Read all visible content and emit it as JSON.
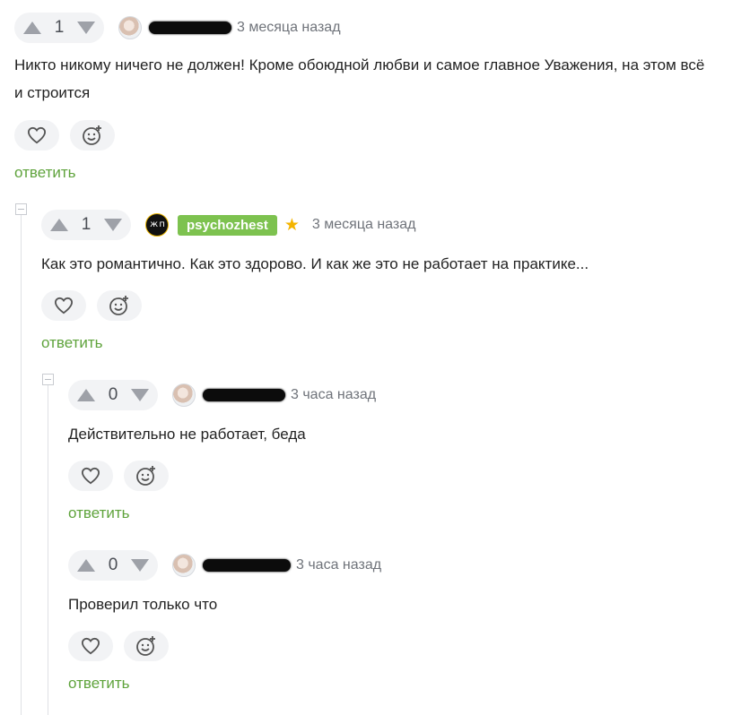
{
  "comments": [
    {
      "votes": "1",
      "author": "",
      "time": "3 месяца назад",
      "text_line1": "Никто никому ничего не должен! Кроме обоюдной любви и самое главное Уважения, на этом всё",
      "text_line2": "и строится",
      "reply_label": "ответить"
    },
    {
      "votes": "1",
      "author": "psychozhest",
      "avatar_text": "ж п",
      "time": "3 месяца назад",
      "text": "Как это романтично. Как это здорово. И как же это не работает на практике...",
      "reply_label": "ответить"
    },
    {
      "votes": "0",
      "author": "",
      "time": "3 часа назад",
      "text": "Действительно не работает, беда",
      "reply_label": "ответить"
    },
    {
      "votes": "0",
      "author": "",
      "time": "3 часа назад",
      "text": "Проверил только что",
      "reply_label": "ответить"
    }
  ],
  "icons": {
    "upvote": "arrow-up-icon",
    "downvote": "arrow-down-icon",
    "like": "heart-icon",
    "reaction": "smiley-plus-icon",
    "collapse": "minus-box-icon",
    "verified": "star-icon"
  },
  "colors": {
    "reply": "#5fa33c",
    "nick_badge": "#7dc24f",
    "star": "#f4b400",
    "pill_bg": "#f2f3f5"
  }
}
